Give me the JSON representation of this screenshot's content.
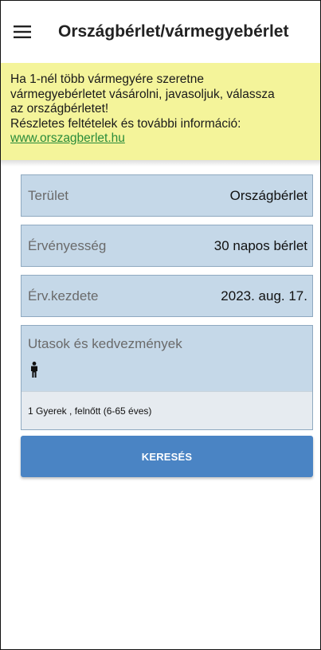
{
  "header": {
    "title": "Országbérlet/vármegyebérlet"
  },
  "banner": {
    "lines": [
      "Ha 1-nél több vármegyére szeretne",
      "vármegyebérletet vásárolni, javasoljuk, válassza",
      "az országbérletet!",
      "Részletes feltételek és további információ:"
    ],
    "link": "www.orszagberlet.hu",
    "background_color": "#f4f49a",
    "link_color": "#2a8c3a"
  },
  "form": {
    "area": {
      "label": "Terület",
      "value": "Országbérlet"
    },
    "validity": {
      "label": "Érvényesség",
      "value": "30 napos bérlet"
    },
    "start": {
      "label": "Érv.kezdete",
      "value": "2023. aug. 17."
    },
    "passengers": {
      "label": "Utasok és kedvezmények",
      "icon": "person-icon",
      "summary": "1 Gyerek , felnőtt (6-65 éves)"
    },
    "field_color": "#c5d8e8"
  },
  "actions": {
    "search_label": "KERESÉS",
    "search_color": "#4a84c4"
  }
}
